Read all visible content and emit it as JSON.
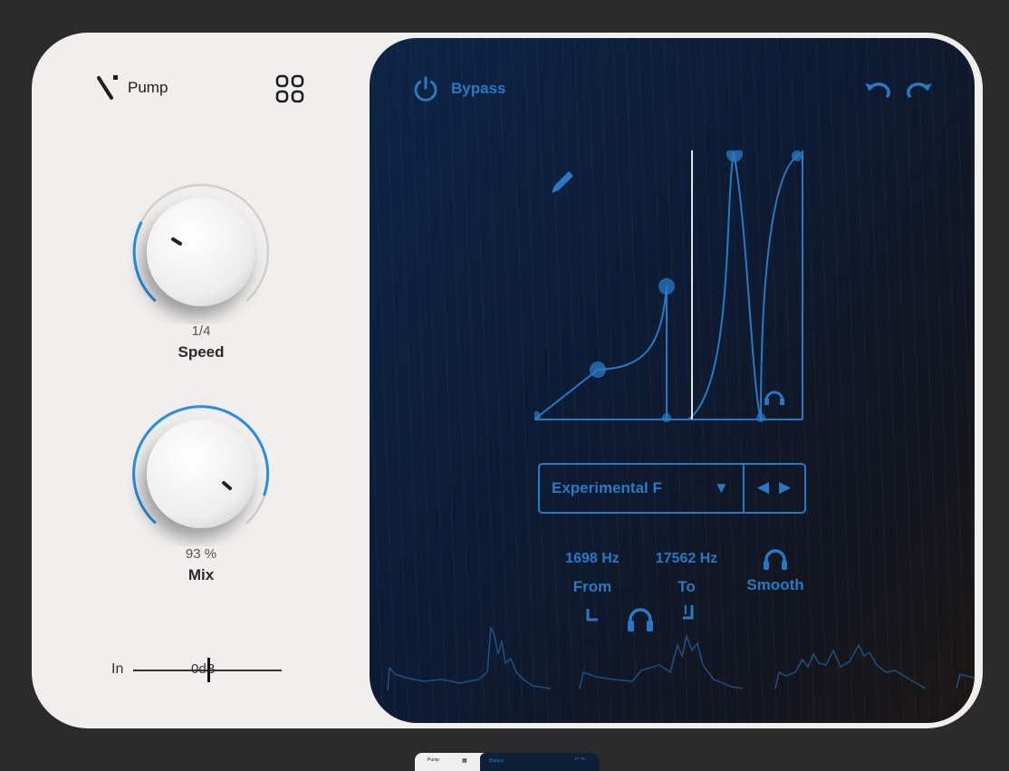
{
  "header": {
    "logo_text": "Pump",
    "grid_icon": "grid-four-icon"
  },
  "knobs": {
    "speed": {
      "value": "1/4",
      "label": "Speed",
      "level": 0.12
    },
    "mix": {
      "value": "93 %",
      "label": "Mix",
      "level": 0.93
    }
  },
  "input": {
    "label": "In",
    "value": "0dB"
  },
  "toolbar": {
    "bypass_label": "Bypass",
    "undo_icon": "undo-icon",
    "redo_icon": "redo-icon"
  },
  "preset": {
    "name": "Experimental F",
    "dropdown_icon": "triangle-down-icon",
    "prev_label": "◀",
    "next_label": "▶"
  },
  "filter": {
    "from_value": "1698 Hz",
    "from_label": "From",
    "to_value": "17562 Hz",
    "to_label": "To",
    "smooth_label": "Smooth"
  },
  "mini_preview": {
    "logo_text": "Pump",
    "bypass_label": "Bypass"
  },
  "colors": {
    "accent": "#2a78c4",
    "panel_light": "#f0efee",
    "panel_dark": "#0d1b33",
    "background": "#2b2b2b"
  }
}
